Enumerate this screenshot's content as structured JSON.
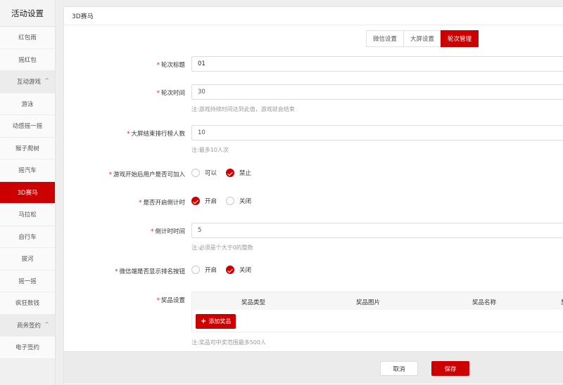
{
  "sidebar": {
    "title": "活动设置",
    "items": [
      {
        "label": "红包雨"
      },
      {
        "label": "摇红包"
      },
      {
        "label": "互动游戏",
        "caret": "^"
      },
      {
        "label": "游泳"
      },
      {
        "label": "动感摇一摇"
      },
      {
        "label": "猴子爬树"
      },
      {
        "label": "摇汽车"
      },
      {
        "label": "3D赛马"
      },
      {
        "label": "马拉松"
      },
      {
        "label": "自行车"
      },
      {
        "label": "拔河"
      },
      {
        "label": "摇一摇"
      },
      {
        "label": "疯狂数钱"
      },
      {
        "label": "商务签约",
        "caret": "^"
      },
      {
        "label": "电子签约"
      }
    ]
  },
  "panel": {
    "title": "3D赛马",
    "tabs": [
      "微信设置",
      "大屏设置",
      "轮次管理"
    ],
    "active_tab": "轮次管理"
  },
  "form": {
    "required_mark": "*",
    "round_title": {
      "label": "轮次标题",
      "value": "01"
    },
    "round_time": {
      "label": "轮次时间",
      "value": "30",
      "note": "注:游戏持续时间达到此值，游戏就会结束"
    },
    "rank_count": {
      "label": "大屏结束排行榜人数",
      "value": "10",
      "note": "注:最多10人次"
    },
    "join_after_start": {
      "label": "游戏开始后用户是否可加入",
      "options": [
        "可以",
        "禁止"
      ],
      "selected": "禁止"
    },
    "countdown_enabled": {
      "label": "是否开启倒计时",
      "options": [
        "开启",
        "关闭"
      ],
      "selected": "开启"
    },
    "countdown_time": {
      "label": "倒计时时间",
      "value": "5",
      "note": "注:必须是个大于0的整数"
    },
    "show_rank_button": {
      "label": "微信端是否显示排名按钮",
      "options": [
        "开启",
        "关闭"
      ],
      "selected": "关闭"
    },
    "prize": {
      "label": "奖品设置",
      "columns": [
        "奖品类型",
        "奖品图片",
        "奖品名称",
        "奖"
      ],
      "add_button": "添加奖品",
      "add_icon": "+",
      "note": "注:奖品可中奖范围最多500人"
    }
  },
  "footer": {
    "cancel": "取消",
    "save": "保存"
  },
  "colors": {
    "accent": "#cc0000",
    "sidebar_bg": "#f0f0f0",
    "note": "#999999"
  }
}
